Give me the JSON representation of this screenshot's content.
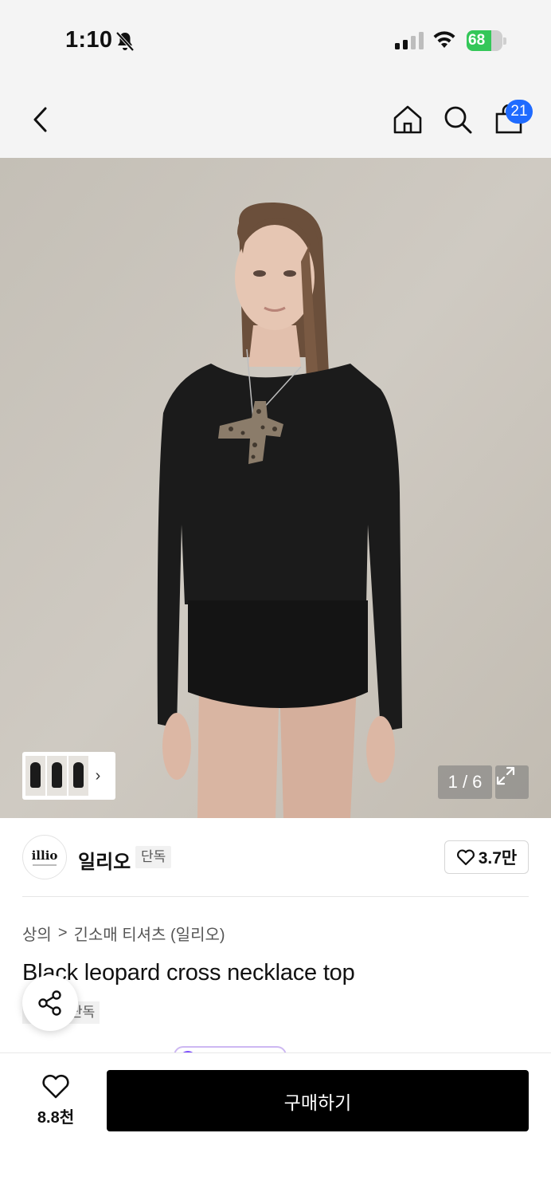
{
  "status_bar": {
    "time": "1:10",
    "battery_percent": "68",
    "battery_level": 0.68
  },
  "nav": {
    "cart_count": "21",
    "icons": [
      "back-icon",
      "home-icon",
      "search-icon",
      "shopping-bag-icon"
    ]
  },
  "gallery": {
    "counter": "1 / 6",
    "current_index": 1,
    "total": 6
  },
  "brand": {
    "logo_text": "illio",
    "name": "일리오",
    "exclusive_label": "단독",
    "like_count": "3.7만"
  },
  "breadcrumb": {
    "category": "상의",
    "separator": ">",
    "subcategory": "긴소매 티셔츠 (일리오)"
  },
  "product": {
    "title": "Black leopard cross necklace top",
    "tag": "단독"
  },
  "bottom_bar": {
    "wish_count": "8.8천",
    "buy_label": "구매하기"
  },
  "colors": {
    "accent_badge": "#1f6bff",
    "battery_green": "#34c759",
    "buy_button": "#000000"
  }
}
